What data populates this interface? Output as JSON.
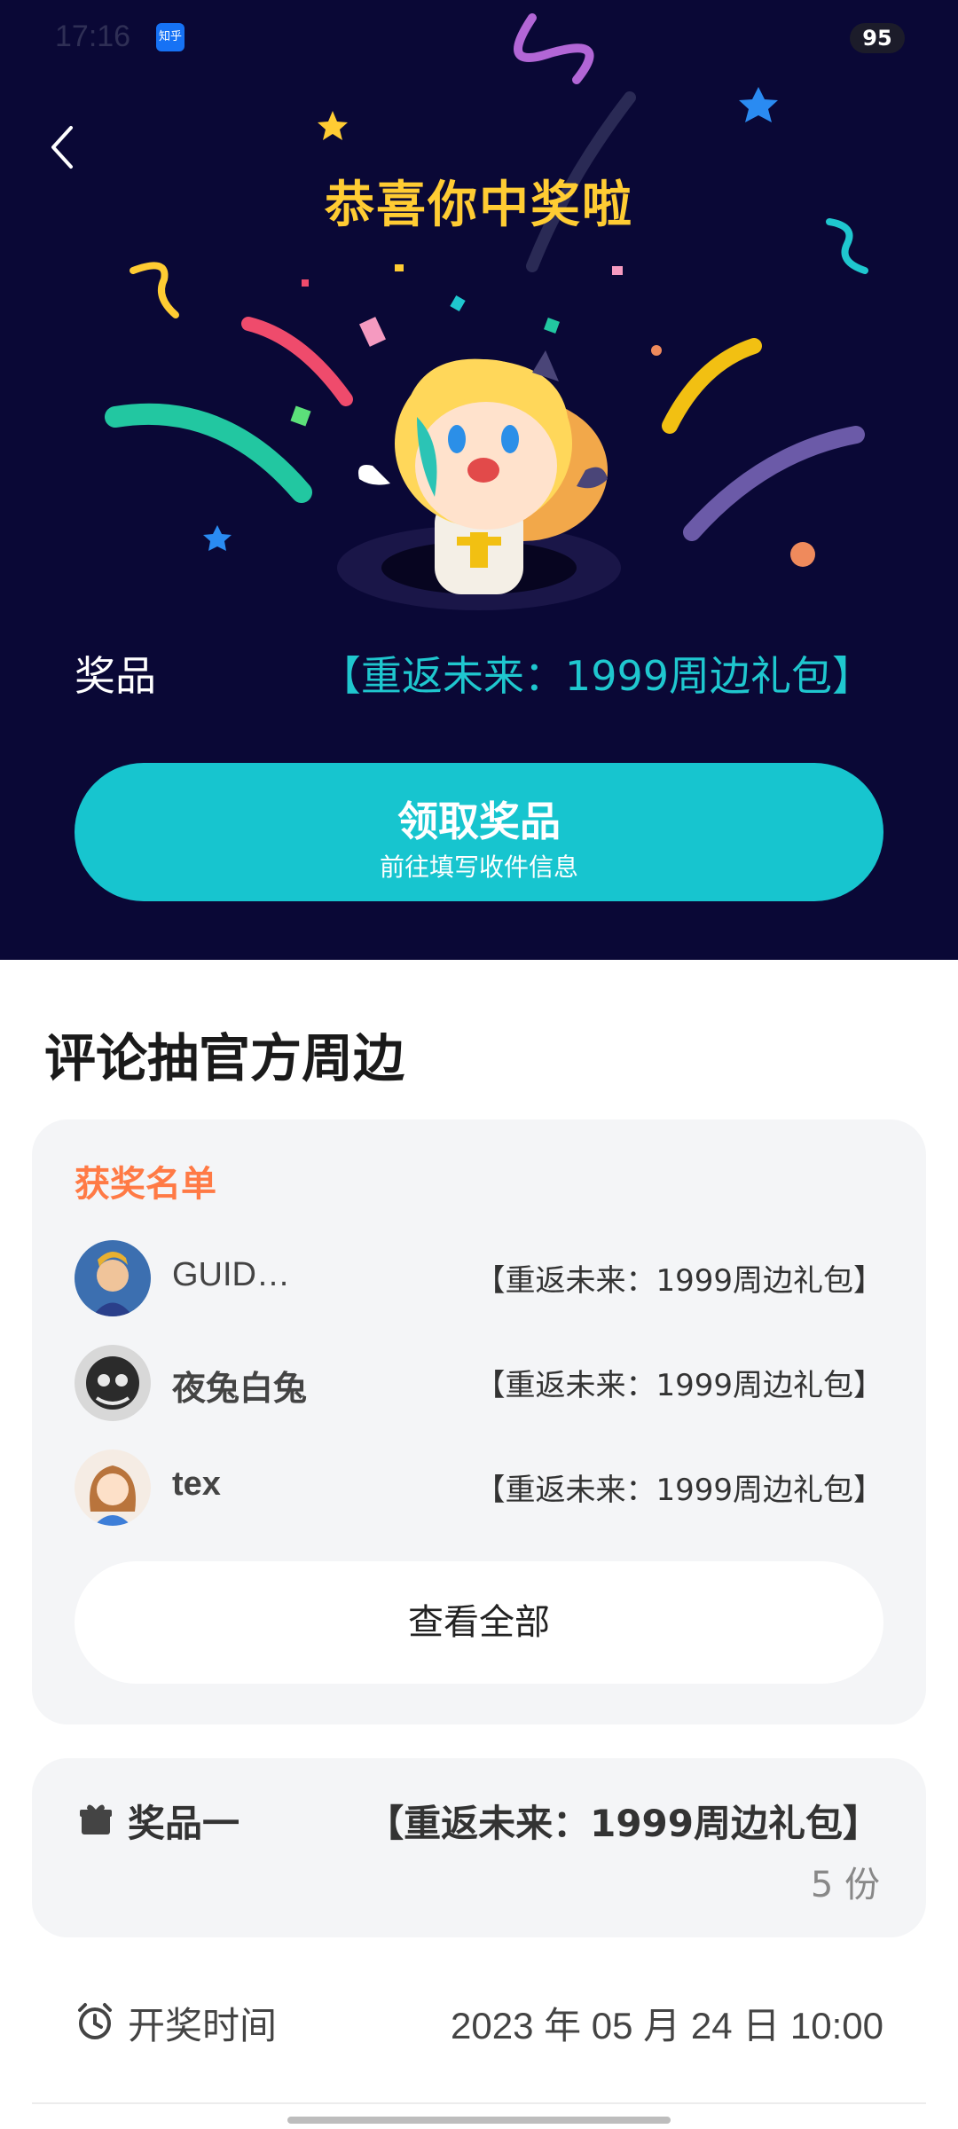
{
  "status_bar": {
    "time": "17:16",
    "battery": "95",
    "zhihu_badge": "知乎"
  },
  "hero": {
    "title": "恭喜你中奖啦",
    "prize_label": "奖品",
    "prize_name": "【重返未来：1999周边礼包】",
    "claim_button": {
      "label": "领取奖品",
      "sublabel": "前往填写收件信息"
    }
  },
  "section_title": "评论抽官方周边",
  "winners": {
    "heading": "获奖名单",
    "items": [
      {
        "name": "GUID…",
        "prize": "【重返未来：1999周边礼包】"
      },
      {
        "name": "夜兔白兔",
        "prize": "【重返未来：1999周边礼包】"
      },
      {
        "name": "tex",
        "prize": "【重返未来：1999周边礼包】"
      }
    ],
    "view_all": "查看全部"
  },
  "prize_card": {
    "label": "奖品一",
    "name": "【重返未来：1999周边礼包】",
    "count": "5 份"
  },
  "draw_time": {
    "label": "开奖时间",
    "value": "2023 年 05 月 24 日 10:00"
  },
  "colors": {
    "hero_bg": "#0a0836",
    "title": "#ffcc33",
    "accent": "#17c5cf",
    "heading": "#ff7a45"
  }
}
